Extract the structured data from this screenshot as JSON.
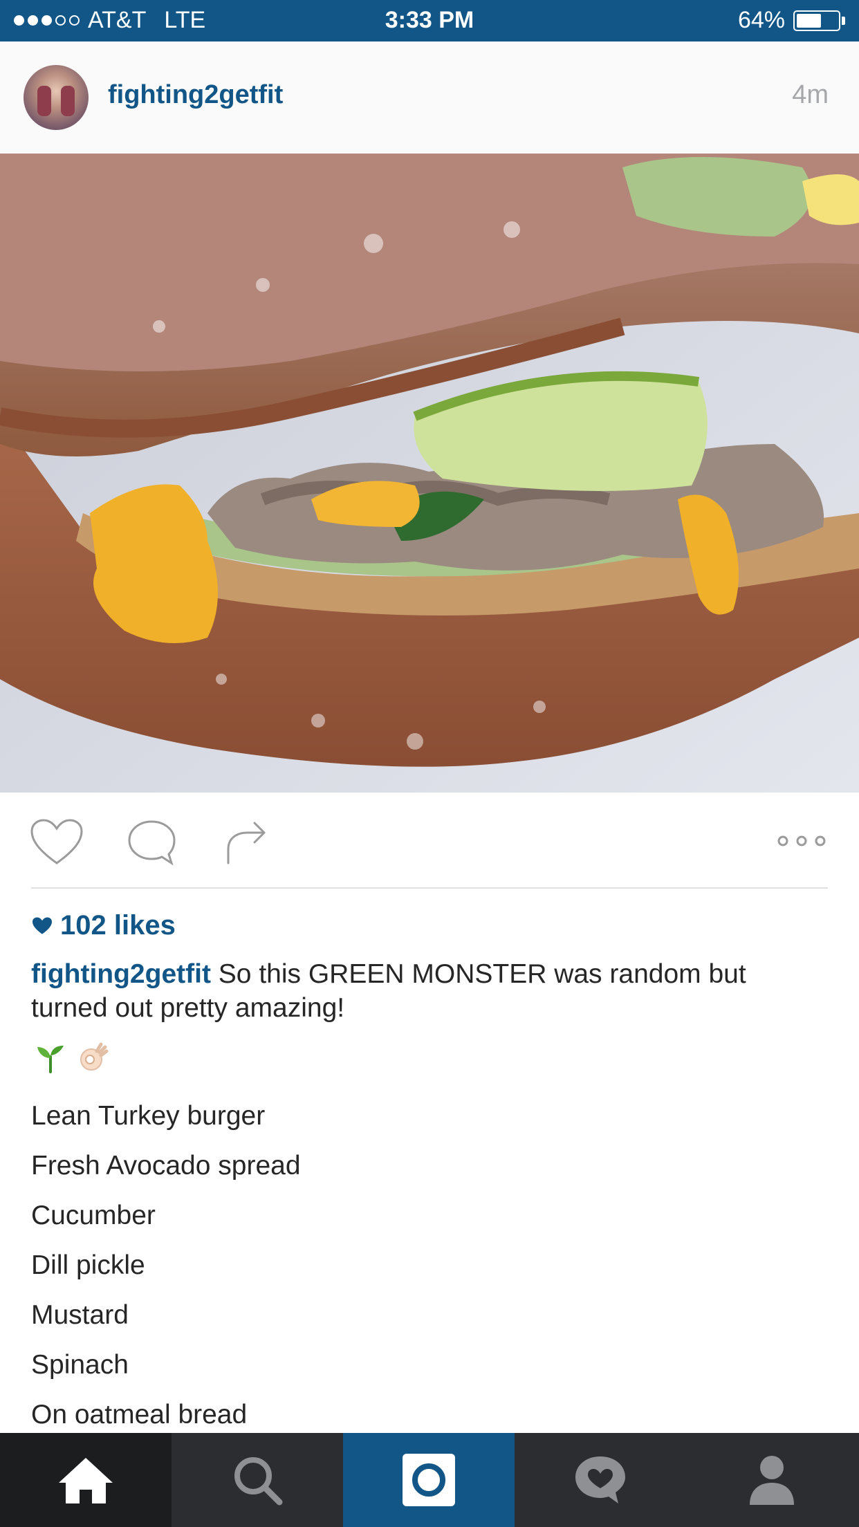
{
  "status_bar": {
    "carrier": "AT&T",
    "network": "LTE",
    "time": "3:33 PM",
    "battery_percent_label": "64%",
    "battery_level": 0.64,
    "signal_bars_filled": 3,
    "signal_bars_total": 5
  },
  "post": {
    "username": "fighting2getfit",
    "time_ago": "4m",
    "photo_icon": "sandwich-photo",
    "likes_label": "102 likes",
    "caption_user": "fighting2getfit",
    "caption_text": "So this GREEN MONSTER was random but turned out pretty amazing!",
    "emojis": [
      "seedling-emoji",
      "ok-hand-emoji"
    ],
    "ingredients": [
      "Lean Turkey burger",
      "Fresh Avocado spread",
      "Cucumber",
      "Dill pickle",
      "Mustard",
      "Spinach",
      "On oatmeal bread"
    ]
  },
  "actions": [
    "heart-icon",
    "comment-icon",
    "share-icon",
    "more-icon"
  ],
  "tab_bar": [
    "home-icon",
    "search-icon",
    "camera-icon",
    "activity-icon",
    "profile-icon"
  ],
  "colors": {
    "brand": "#125688",
    "text": "#262626",
    "muted": "#a5a7aa",
    "tab_bar": "#2b2d30"
  }
}
